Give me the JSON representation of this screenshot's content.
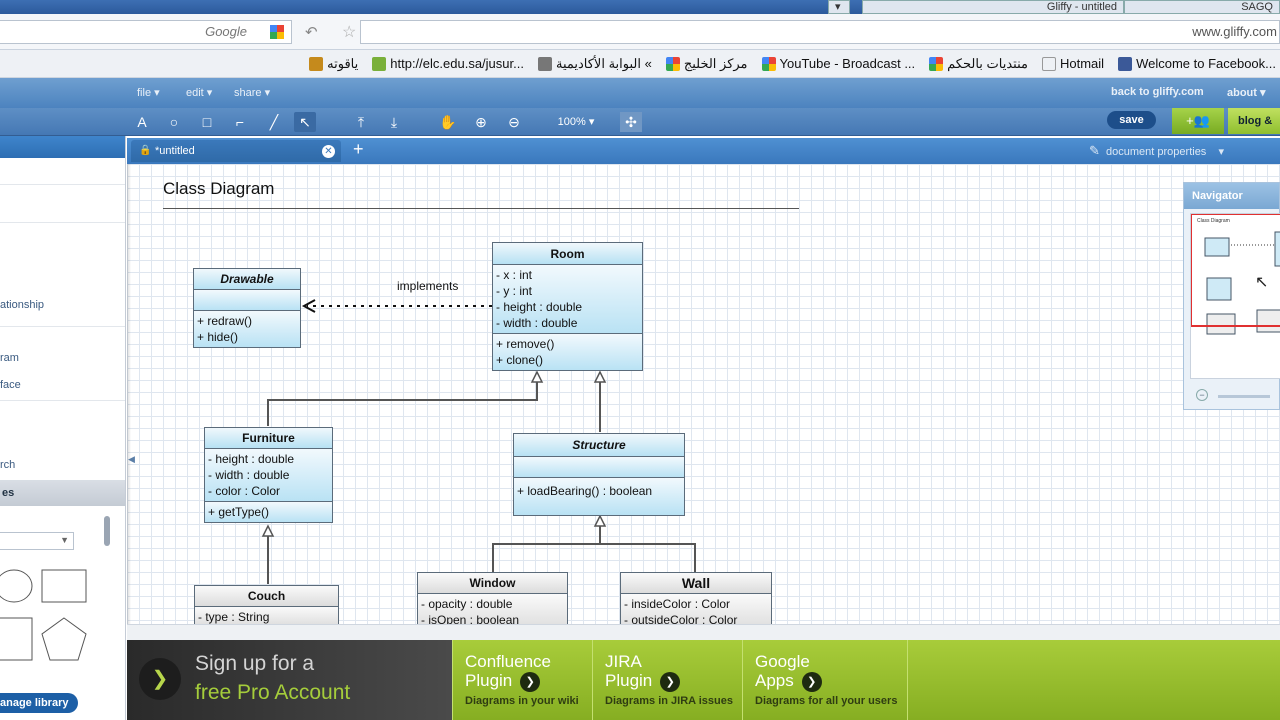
{
  "browser": {
    "tab_title": "Gliffy - untitled",
    "right_tab": "SAGQ",
    "search_placeholder": "Google",
    "url_fragment": "www.gliffy.com"
  },
  "bookmarks": [
    {
      "label": "Welcome to Facebook...",
      "color": "#3b5998"
    },
    {
      "label": "Hotmail",
      "color": "#ffffff"
    },
    {
      "label": "منتديات بالحكم",
      "color": "#4285f4"
    },
    {
      "label": "YouTube - Broadcast ...",
      "color": "#e52d27"
    },
    {
      "label": "مركز الخليج",
      "color": "#34a853"
    },
    {
      "label": "البوابة الأكاديمية «",
      "color": "#777777"
    },
    {
      "label": "http://elc.edu.sa/jusur...",
      "color": "#7ab03a"
    },
    {
      "label": "ياقوته",
      "color": "#c58a1c"
    }
  ],
  "menu": {
    "file": "file",
    "edit": "edit",
    "share": "share",
    "back": "back to gliffy.com",
    "about": "about"
  },
  "toolbar": {
    "zoom": "100%",
    "save": "save",
    "blog": "blog &"
  },
  "left_panel": {
    "items": [
      "ationship",
      "ram",
      "face",
      "rch"
    ],
    "shapes_header": "es",
    "manage_library": "anage library"
  },
  "document": {
    "tab_label": "*untitled",
    "properties": "document properties"
  },
  "diagram": {
    "title": "Class Diagram",
    "implements_label": "implements",
    "drawable": {
      "name": "Drawable",
      "methods": [
        "+ redraw()",
        "+ hide()"
      ]
    },
    "room": {
      "name": "Room",
      "attributes": [
        "- x : int",
        "- y : int",
        "- height : double",
        "- width : double"
      ],
      "methods": [
        "+ remove()",
        "+ clone()"
      ]
    },
    "furniture": {
      "name": "Furniture",
      "attributes": [
        "- height : double",
        "- width : double",
        "- color : Color"
      ],
      "methods": [
        "+ getType()"
      ]
    },
    "structure": {
      "name": "Structure",
      "methods": [
        "+ loadBearing() : boolean"
      ]
    },
    "couch": {
      "name": "Couch",
      "attributes": [
        "- type : String"
      ]
    },
    "window": {
      "name": "Window",
      "attributes": [
        "- opacity : double",
        "- isOpen : boolean"
      ]
    },
    "wall": {
      "name": "Wall",
      "attributes": [
        "- insideColor : Color",
        "- outsideColor : Color"
      ]
    }
  },
  "navigator": {
    "title": "Navigator",
    "thumb_title": "Class Diagram"
  },
  "ads": {
    "signup_line1": "Sign up for a",
    "signup_line2": "free Pro Account",
    "confluence": {
      "t1": "Confluence",
      "t2": "Plugin",
      "sub": "Diagrams in your wiki"
    },
    "jira": {
      "t1": "JIRA",
      "t2": "Plugin",
      "sub": "Diagrams in JIRA issues"
    },
    "google": {
      "t1": "Google",
      "t2": "Apps",
      "sub": "Diagrams for all your users"
    }
  }
}
